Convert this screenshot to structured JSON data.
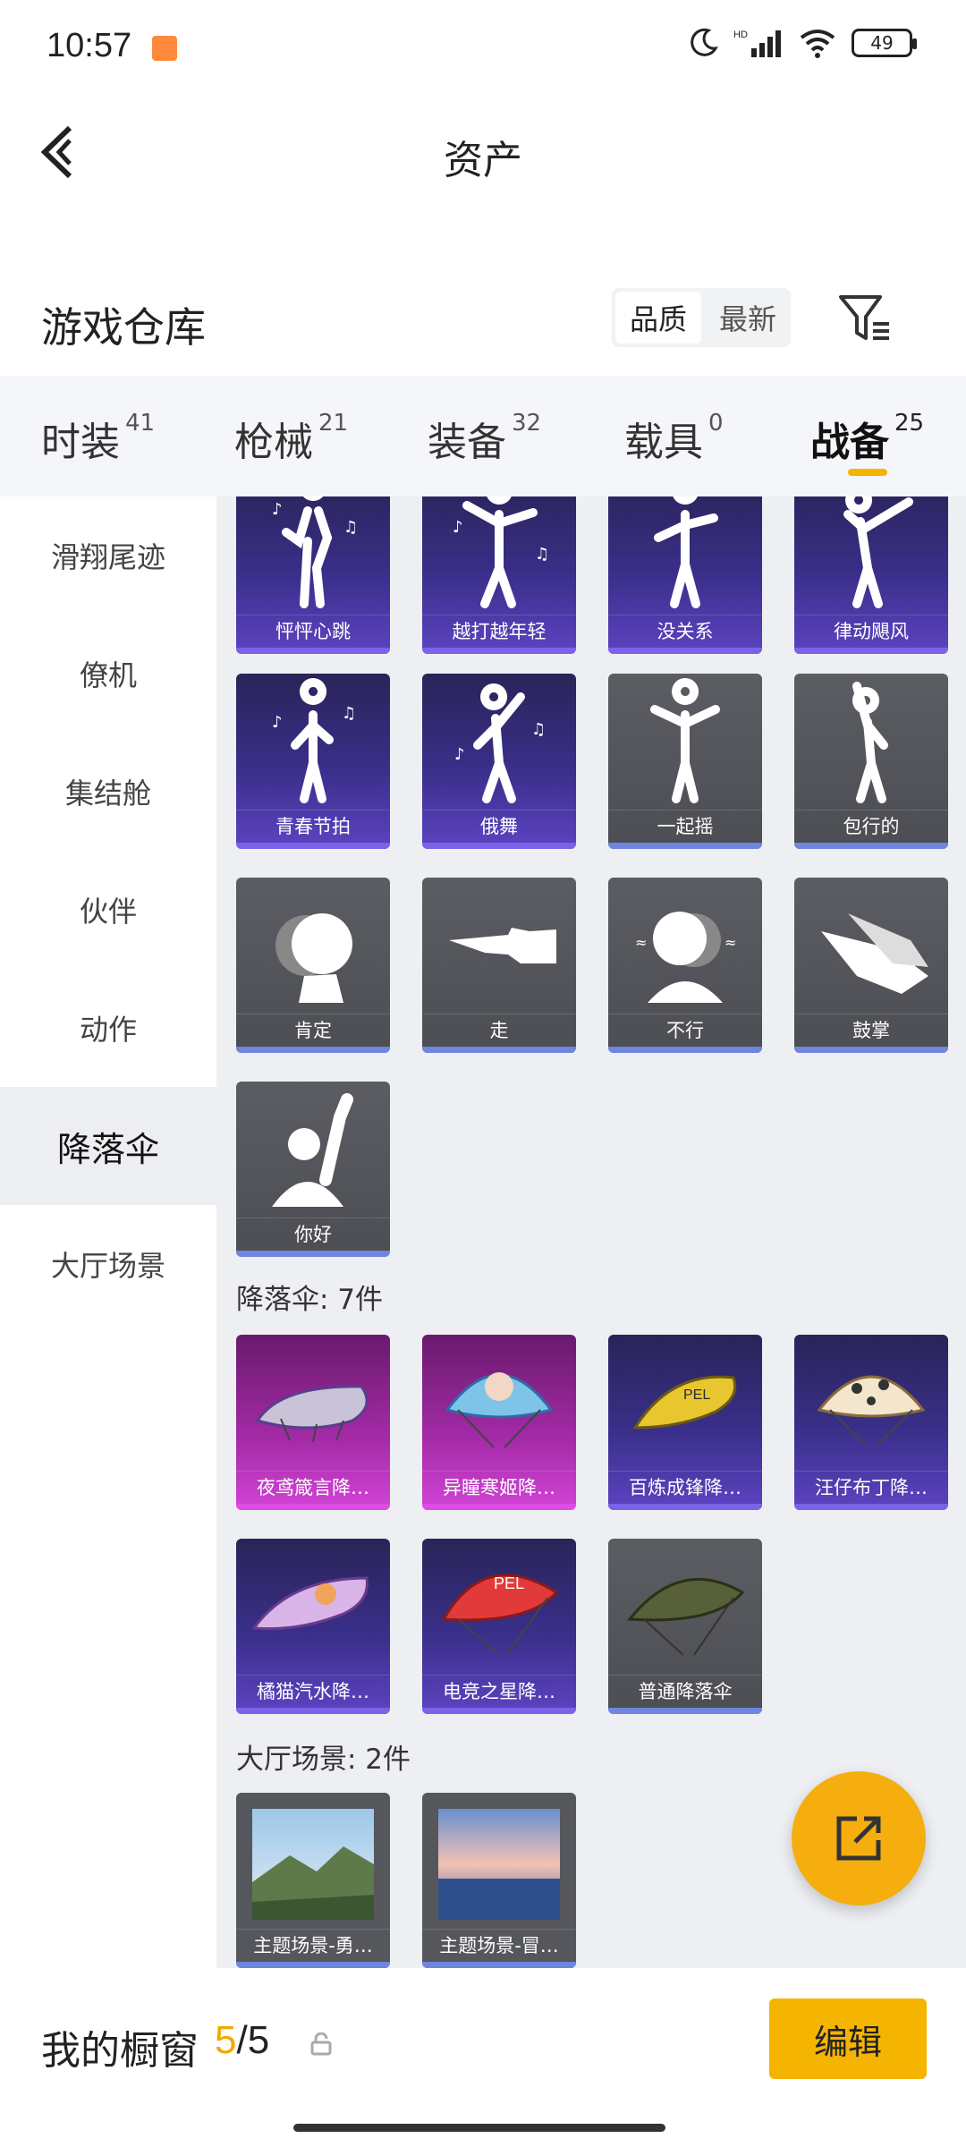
{
  "status_bar": {
    "time": "10:57",
    "battery": "49"
  },
  "header": {
    "title": "资产"
  },
  "warehouse": {
    "title": "游戏仓库",
    "sort_options": [
      "品质",
      "最新"
    ],
    "sort_selected": "品质"
  },
  "tabs": [
    {
      "label": "时装",
      "count": "41"
    },
    {
      "label": "枪械",
      "count": "21"
    },
    {
      "label": "装备",
      "count": "32"
    },
    {
      "label": "载具",
      "count": "0"
    },
    {
      "label": "战备",
      "count": "25",
      "active": true
    }
  ],
  "sidebar": [
    {
      "label": "滑翔尾迹"
    },
    {
      "label": "僚机"
    },
    {
      "label": "集结舱"
    },
    {
      "label": "伙伴"
    },
    {
      "label": "动作"
    },
    {
      "label": "降落伞",
      "active": true
    },
    {
      "label": "大厅场景"
    }
  ],
  "actions": [
    {
      "label": "怦怦心跳",
      "rarity": "purple"
    },
    {
      "label": "越打越年轻",
      "rarity": "purple"
    },
    {
      "label": "没关系",
      "rarity": "purple"
    },
    {
      "label": "律动飓风",
      "rarity": "purple"
    },
    {
      "label": "青春节拍",
      "rarity": "purple"
    },
    {
      "label": "俄舞",
      "rarity": "purple"
    },
    {
      "label": "一起摇",
      "rarity": "gray"
    },
    {
      "label": "包行的",
      "rarity": "gray"
    },
    {
      "label": "肯定",
      "rarity": "gray"
    },
    {
      "label": "走",
      "rarity": "gray"
    },
    {
      "label": "不行",
      "rarity": "gray"
    },
    {
      "label": "鼓掌",
      "rarity": "gray"
    },
    {
      "label": "你好",
      "rarity": "gray"
    }
  ],
  "parachute_section": {
    "title": "降落伞: 7件"
  },
  "parachutes": [
    {
      "label": "夜鸢箴言降…",
      "rarity": "magenta"
    },
    {
      "label": "异瞳寒姬降…",
      "rarity": "magenta"
    },
    {
      "label": "百炼成锋降…",
      "rarity": "purple"
    },
    {
      "label": "汪仔布丁降…",
      "rarity": "purple"
    },
    {
      "label": "橘猫汽水降…",
      "rarity": "purple"
    },
    {
      "label": "电竞之星降…",
      "rarity": "purple"
    },
    {
      "label": "普通降落伞",
      "rarity": "gray"
    }
  ],
  "lobby_section": {
    "title": "大厅场景: 2件"
  },
  "lobby_scenes": [
    {
      "label": "主题场景-勇…"
    },
    {
      "label": "主题场景-冒…"
    }
  ],
  "showcase": {
    "title": "我的橱窗",
    "current": "5",
    "total": "/5",
    "edit_label": "编辑"
  },
  "colors": {
    "accent": "#f5b400",
    "purple_rarity": "#5d43c2",
    "magenta_rarity": "#d244d6",
    "gray_rarity": "#4c4e54"
  }
}
